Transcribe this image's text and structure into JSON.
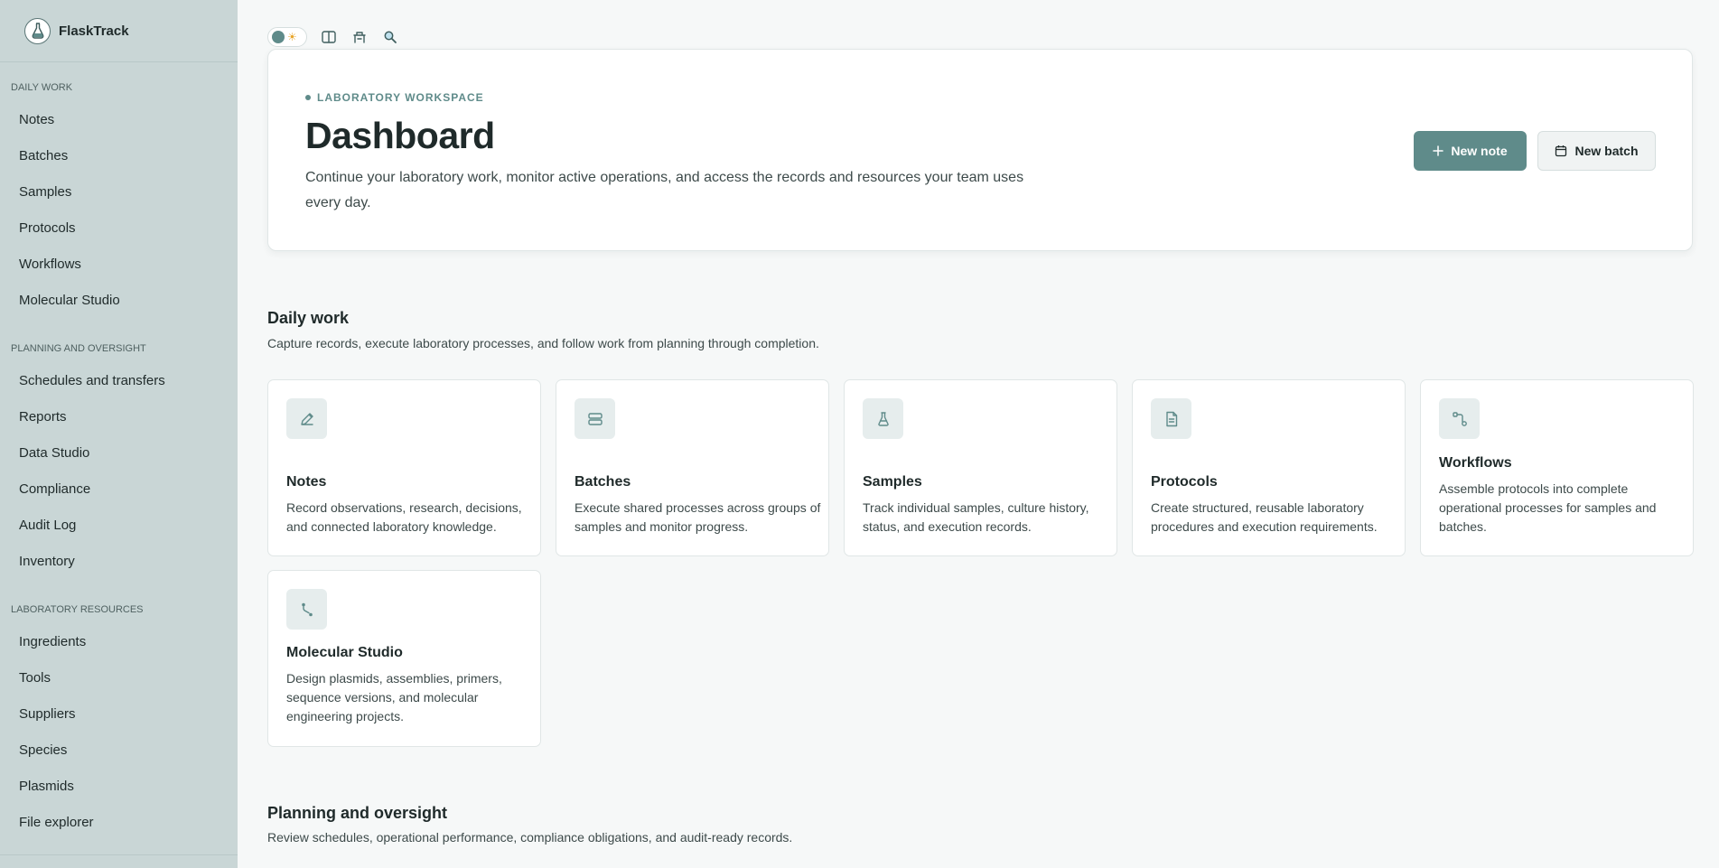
{
  "app": {
    "name": "FlaskTrack"
  },
  "sidebar": {
    "sections": [
      {
        "title": "DAILY WORK",
        "items": [
          "Notes",
          "Batches",
          "Samples",
          "Protocols",
          "Workflows",
          "Molecular Studio"
        ]
      },
      {
        "title": "PLANNING AND OVERSIGHT",
        "items": [
          "Schedules and transfers",
          "Reports",
          "Data Studio",
          "Compliance",
          "Audit Log",
          "Inventory"
        ]
      },
      {
        "title": "LABORATORY RESOURCES",
        "items": [
          "Ingredients",
          "Tools",
          "Suppliers",
          "Species",
          "Plasmids",
          "File explorer"
        ]
      }
    ]
  },
  "toolbar": {
    "icons": [
      "theme-toggle",
      "split-view-icon",
      "bench-icon",
      "search-icon"
    ]
  },
  "hero": {
    "eyebrow": "LABORATORY WORKSPACE",
    "title": "Dashboard",
    "description": "Continue your laboratory work, monitor active operations, and access the records and resources your team uses every day.",
    "primary_button": "New note",
    "secondary_button": "New batch"
  },
  "daily_work": {
    "title": "Daily work",
    "description": "Capture records, execute laboratory processes, and follow work from planning through completion.",
    "cards": [
      {
        "title": "Notes",
        "description": "Record observations, research, decisions, and connected laboratory knowledge.",
        "icon": "pencil-icon"
      },
      {
        "title": "Batches",
        "description": "Execute shared processes across groups of samples and monitor progress.",
        "icon": "stack-icon"
      },
      {
        "title": "Samples",
        "description": "Track individual samples, culture history, status, and execution records.",
        "icon": "flask-icon"
      },
      {
        "title": "Protocols",
        "description": "Create structured, reusable laboratory procedures and execution requirements.",
        "icon": "document-icon"
      },
      {
        "title": "Workflows",
        "description": "Assemble protocols into complete operational processes for samples and batches.",
        "icon": "workflow-icon"
      },
      {
        "title": "Molecular Studio",
        "description": "Design plasmids, assemblies, primers, sequence versions, and molecular engineering projects.",
        "icon": "molecule-icon"
      }
    ]
  },
  "planning": {
    "title": "Planning and oversight",
    "description": "Review schedules, operational performance, compliance obligations, and audit-ready records."
  },
  "colors": {
    "accent": "#5f8b8a",
    "sidebar": "#c9d6d6",
    "background": "#f6f8f8"
  }
}
